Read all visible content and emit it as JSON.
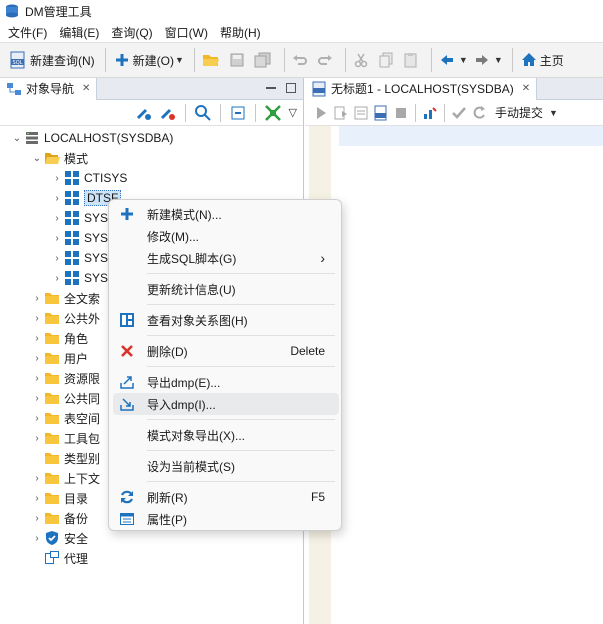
{
  "window": {
    "title": "DM管理工具"
  },
  "menubar": [
    "文件(F)",
    "编辑(E)",
    "查询(Q)",
    "窗口(W)",
    "帮助(H)"
  ],
  "toolbar": {
    "new_query": "新建查询(N)",
    "new": "新建(O)",
    "home": "主页"
  },
  "nav_panel": {
    "tab_label": "对象导航",
    "tree": [
      {
        "label": "LOCALHOST(SYSDBA)",
        "icon": "server-icon",
        "expanded": true
      },
      {
        "label": "模式",
        "icon": "folder-open-icon",
        "expanded": true
      },
      {
        "label": "CTISYS",
        "icon": "schema-icon"
      },
      {
        "label": "DTSF",
        "icon": "schema-icon",
        "selected": true
      },
      {
        "label": "SYS",
        "icon": "schema-icon"
      },
      {
        "label": "SYS",
        "icon": "schema-icon"
      },
      {
        "label": "SYS",
        "icon": "schema-icon"
      },
      {
        "label": "SYS",
        "icon": "schema-icon"
      },
      {
        "label": "全文索",
        "icon": "folder-icon"
      },
      {
        "label": "公共外",
        "icon": "folder-icon"
      },
      {
        "label": "角色",
        "icon": "folder-icon"
      },
      {
        "label": "用户",
        "icon": "folder-icon"
      },
      {
        "label": "资源限",
        "icon": "folder-icon"
      },
      {
        "label": "公共同",
        "icon": "folder-icon"
      },
      {
        "label": "表空间",
        "icon": "folder-icon"
      },
      {
        "label": "工具包",
        "icon": "folder-icon"
      },
      {
        "label": "类型别",
        "icon": "folder-icon"
      },
      {
        "label": "上下文",
        "icon": "folder-icon"
      },
      {
        "label": "目录",
        "icon": "folder-icon"
      },
      {
        "label": "备份",
        "icon": "folder-icon"
      },
      {
        "label": "安全",
        "icon": "shield-check-icon"
      },
      {
        "label": "代理",
        "icon": "proxy-icon"
      }
    ]
  },
  "editor": {
    "tab_label": "无标题1 - LOCALHOST(SYSDBA)",
    "commit_mode": "手动提交"
  },
  "context_menu": {
    "items": [
      {
        "label": "新建模式(N)...",
        "icon": "plus-icon"
      },
      {
        "label": "修改(M)...",
        "icon": ""
      },
      {
        "label": "生成SQL脚本(G)",
        "icon": "",
        "submenu": true
      },
      {
        "label": "更新统计信息(U)",
        "icon": ""
      },
      {
        "label": "查看对象关系图(H)",
        "icon": "diagram-icon"
      },
      {
        "label": "删除(D)",
        "icon": "delete-icon",
        "shortcut": "Delete"
      },
      {
        "label": "导出dmp(E)...",
        "icon": "export-icon"
      },
      {
        "label": "导入dmp(I)...",
        "icon": "import-icon",
        "hovered": true
      },
      {
        "label": "模式对象导出(X)...",
        "icon": ""
      },
      {
        "label": "设为当前模式(S)",
        "icon": ""
      },
      {
        "label": "刷新(R)",
        "icon": "refresh-icon",
        "shortcut": "F5"
      },
      {
        "label": "属性(P)",
        "icon": "properties-icon"
      }
    ]
  },
  "colors": {
    "accent": "#1e73be",
    "folder": "#f2b825",
    "selection": "#cde3f7",
    "delete": "#d9352b"
  }
}
